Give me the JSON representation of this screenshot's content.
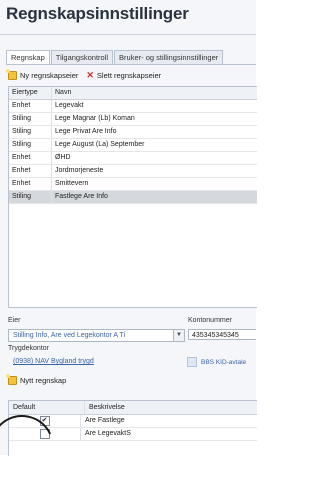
{
  "page": {
    "title": "Regnskapsinnstillinger"
  },
  "tabs": [
    {
      "label": "Regnskap"
    },
    {
      "label": "Tilgangskontroll"
    },
    {
      "label": "Bruker- og stillingsinnstillinger"
    }
  ],
  "toolbar": {
    "new_label": "Ny regnskapseier",
    "delete_label": "Slett regnskapseier"
  },
  "owners_table": {
    "headers": [
      "Eiertype",
      "Navn"
    ],
    "rows": [
      {
        "type": "Enhet",
        "name": "Legevakt"
      },
      {
        "type": "Stiling",
        "name": "Lege Magnar (Lb) Koman"
      },
      {
        "type": "Stiling",
        "name": "Lege Privat Are Info"
      },
      {
        "type": "Stiling",
        "name": "Lege August (La) September"
      },
      {
        "type": "Enhet",
        "name": "ØHD"
      },
      {
        "type": "Enhet",
        "name": "Jordmorjeneste"
      },
      {
        "type": "Enhet",
        "name": "Smittevern"
      },
      {
        "type": "Stiling",
        "name": "Fastlege Are Info"
      }
    ],
    "selected_index": 7
  },
  "form": {
    "owner_label": "Eier",
    "owner_value": "Stilling Info, Are ved Legekontor A Ti",
    "account_label": "Kontonummer",
    "account_value": "435345345345",
    "trygd_label": "Trygdekontor",
    "trygd_value": "(0938) NAV Bygland trygd",
    "kid_label": "BBS KID-avtale"
  },
  "toolbar2": {
    "new_label": "Nytt regnskap"
  },
  "accounts_table": {
    "headers": [
      "Default",
      "Beskrivelse"
    ],
    "rows": [
      {
        "default": "✔",
        "desc": "Are Fastlege"
      },
      {
        "default": "",
        "desc": "Are LegevaktS"
      }
    ]
  }
}
